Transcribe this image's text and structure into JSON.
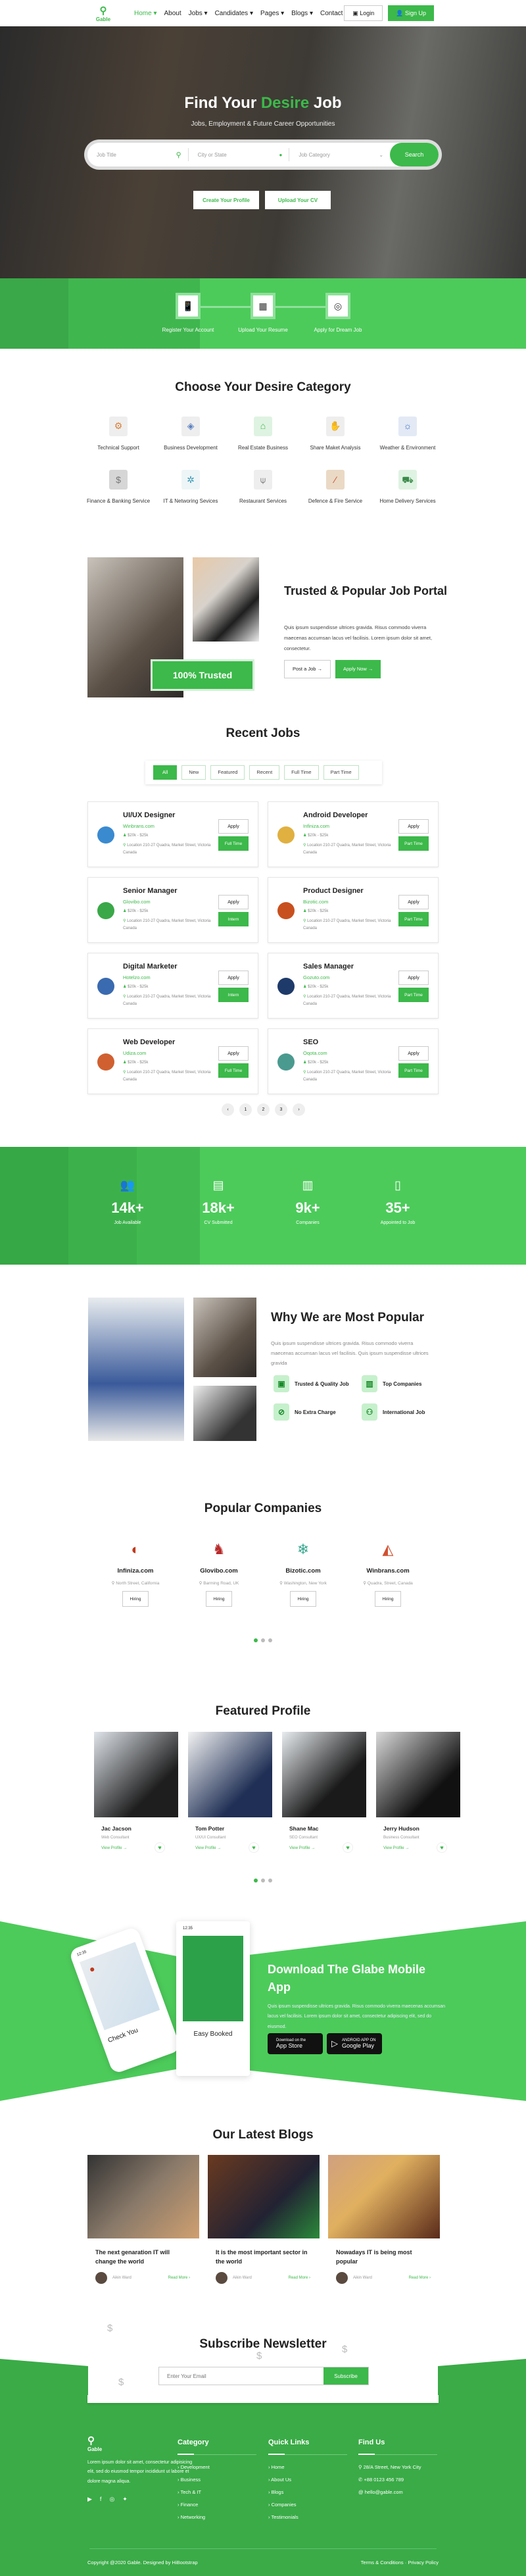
{
  "brand": {
    "name": "Gable",
    "accent": "#3cb94a"
  },
  "nav": {
    "items": [
      "Home",
      "About",
      "Jobs",
      "Candidates",
      "Pages",
      "Blogs",
      "Contact"
    ],
    "login": "Login",
    "signup": "Sign Up"
  },
  "hero": {
    "title_pre": "Find Your ",
    "title_accent": "Desire",
    "title_post": " Job",
    "subtitle": "Jobs, Employment & Future Career Opportunities",
    "search": {
      "job_title_placeholder": "Job Title",
      "city_placeholder": "City or State",
      "category_placeholder": "Job Category",
      "button": "Search"
    },
    "buttons": [
      "Create Your Profile",
      "Upload Your CV"
    ]
  },
  "steps": [
    "Register Your Account",
    "Upload Your Resume",
    "Apply for Dream Job"
  ],
  "categories": {
    "title": "Choose Your Desire Category",
    "items": [
      "Technical Support",
      "Business Development",
      "Real Estate Business",
      "Share Maket Analysis",
      "Weather & Environment",
      "Finance & Banking Service",
      "IT & Networing Sevices",
      "Restaurant Services",
      "Defence & Fire Service",
      "Home Delivery Services"
    ]
  },
  "trusted": {
    "badge": "100% Trusted",
    "title": "Trusted & Popular Job Portal",
    "text": "Quis ipsum suspendisse ultrices gravida. Risus commodo viverra maecenas accumsan lacus vel facilisis. Lorem ipsum dolor sit amet, consectetur.",
    "post_job": "Post a Job →",
    "apply_now": "Apply Now →"
  },
  "jobs": {
    "title": "Recent Jobs",
    "filters": [
      "All",
      "New",
      "Featured",
      "Recent",
      "Full Time",
      "Part Time"
    ],
    "active_filter": "All",
    "apply_label": "Apply",
    "items": [
      {
        "title": "UI/UX Designer",
        "company": "Winbrans.com",
        "salary": "$20k - $25k",
        "location": "Location 210-27 Quadra, Market Street, Victoria Canada",
        "type": "Full Time"
      },
      {
        "title": "Android Developer",
        "company": "Infiniza.com",
        "salary": "$20k - $25k",
        "location": "Location 210-27 Quadra, Market Street, Victoria Canada",
        "type": "Part Time"
      },
      {
        "title": "Senior Manager",
        "company": "Glovibo.com",
        "salary": "$20k - $25k",
        "location": "Location 210-27 Quadra, Market Street, Victoria Canada",
        "type": "Intern"
      },
      {
        "title": "Product Designer",
        "company": "Bizotic.com",
        "salary": "$20k - $25k",
        "location": "Location 210-27 Quadra, Market Street, Victoria Canada",
        "type": "Part Time"
      },
      {
        "title": "Digital Marketer",
        "company": "Hotelzo.com",
        "salary": "$20k - $25k",
        "location": "Location 210-27 Quadra, Market Street, Victoria Canada",
        "type": "Intern"
      },
      {
        "title": "Sales Manager",
        "company": "Gozuto.com",
        "salary": "$20k - $25k",
        "location": "Location 210-27 Quadra, Market Street, Victoria Canada",
        "type": "Part Time"
      },
      {
        "title": "Web Developer",
        "company": "Udiza.com",
        "salary": "$20k - $25k",
        "location": "Location 210-27 Quadra, Market Street, Victoria Canada",
        "type": "Full Time"
      },
      {
        "title": "SEO",
        "company": "Oqota.com",
        "salary": "$20k - $25k",
        "location": "Location 210-27 Quadra, Market Street, Victoria Canada",
        "type": "Part Time"
      }
    ],
    "pages": [
      "‹",
      "1",
      "2",
      "3",
      "›"
    ]
  },
  "stats": [
    {
      "value": "14k+",
      "label": "Job Available"
    },
    {
      "value": "18k+",
      "label": "CV Submitted"
    },
    {
      "value": "9k+",
      "label": "Companies"
    },
    {
      "value": "35+",
      "label": "Appointed to Job"
    }
  ],
  "why": {
    "title": "Why We are Most Popular",
    "text": "Quis ipsum suspendisse ultrices gravida. Risus commodo viverra maecenas accumsan lacus vel facilisis. Quis ipsum suspendisse ultrices gravida",
    "features": [
      "Trusted & Quality Job",
      "Top Companies",
      "No Extra Charge",
      "International Job"
    ]
  },
  "companies": {
    "title": "Popular Companies",
    "hiring": "Hiring",
    "items": [
      {
        "name": "Infiniza.com",
        "address": "North Street, California"
      },
      {
        "name": "Glovibo.com",
        "address": "Barming Road, UK"
      },
      {
        "name": "Bizotic.com",
        "address": "Washington, New York"
      },
      {
        "name": "Winbrans.com",
        "address": "Quadra, Street, Canada"
      }
    ]
  },
  "profiles": {
    "title": "Featured Profile",
    "view": "View Profile →",
    "items": [
      {
        "name": "Jac Jacson",
        "role": "Web Consultant"
      },
      {
        "name": "Tom Potter",
        "role": "UX/UI Consultant"
      },
      {
        "name": "Shane Mac",
        "role": "SEO Consultant"
      },
      {
        "name": "Jerry Hudson",
        "role": "Business Consultant"
      }
    ]
  },
  "app": {
    "title": "Download The Glabe Mobile App",
    "text": "Quis ipsum suspendisse ultrices gravida. Risus commodo viverra maecenas accumsan lacus vel facilisis. Lorem ipsum dolor sit amet, consectetur adipiscing elit, sed do eiusmod.",
    "phone_time": "12:35",
    "phone1_caption": "Check You",
    "phone2_caption": "Easy Booked",
    "appstore_small": "Download on the",
    "appstore": "App Store",
    "gplay_small": "ANDROID APP ON",
    "gplay": "Google Play"
  },
  "blogs": {
    "title": "Our Latest Blogs",
    "read_more": "Read More ›",
    "items": [
      {
        "title": "The next genaration IT will change the world",
        "author": "Aikin Ward"
      },
      {
        "title": "It is the most important sector in the world",
        "author": "Aikin Ward"
      },
      {
        "title": "Nowadays IT is being most popular",
        "author": "Aikin Ward"
      }
    ]
  },
  "newsletter": {
    "title": "Subscribe Newsletter",
    "placeholder": "Enter Your Email",
    "button": "Subscribe"
  },
  "footer": {
    "about": "Lorem ipsum dolor sit amet, consectetur adipisicing elit, sed do eiusmod tempor incididunt ut labore et dolore magna aliqua.",
    "category_title": "Category",
    "categories": [
      "Development",
      "Business",
      "Tech & IT",
      "Finance",
      "Networking"
    ],
    "links_title": "Quick Links",
    "links": [
      "Home",
      "About Us",
      "Blogs",
      "Companies",
      "Testimonials"
    ],
    "find_title": "Find Us",
    "address": "28/A Street, New York City",
    "phone": "+88 0123 456 789",
    "email": "hello@gable.com",
    "copyright": "Copyright @2020 Gable. Designed by HiBootstrap",
    "terms": "Terms & Conditions",
    "privacy": "Privacy Policy"
  }
}
